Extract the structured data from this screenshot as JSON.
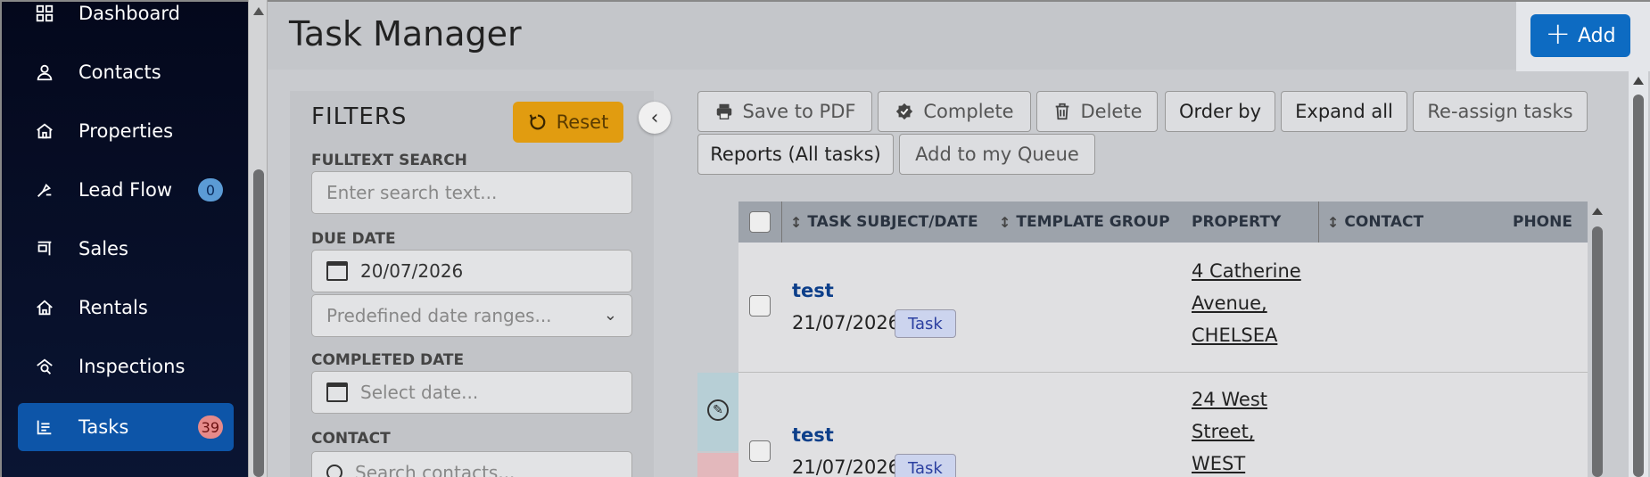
{
  "sidebar": {
    "items": [
      {
        "label": "Dashboard",
        "icon": "dashboard-icon"
      },
      {
        "label": "Contacts",
        "icon": "person-icon"
      },
      {
        "label": "Properties",
        "icon": "house-icon"
      },
      {
        "label": "Lead Flow",
        "icon": "lead-flow-icon",
        "badge": "0"
      },
      {
        "label": "Sales",
        "icon": "sales-sign-icon"
      },
      {
        "label": "Rentals",
        "icon": "rental-house-icon"
      },
      {
        "label": "Inspections",
        "icon": "inspection-icon"
      },
      {
        "label": "Tasks",
        "icon": "tasks-icon",
        "badge": "39"
      }
    ]
  },
  "header": {
    "title": "Task Manager",
    "add_label": "Add"
  },
  "filters": {
    "title": "FILTERS",
    "reset_label": "Reset",
    "fulltext_label": "FULLTEXT SEARCH",
    "fulltext_placeholder": "Enter search text...",
    "due_date_label": "DUE DATE",
    "due_date_value": "20/07/2026",
    "date_range_placeholder": "Predefined date ranges...",
    "completed_date_label": "COMPLETED DATE",
    "completed_date_placeholder": "Select date...",
    "contact_label": "CONTACT",
    "contact_placeholder": "Search contacts..."
  },
  "toolbar": {
    "save_pdf": "Save to PDF",
    "complete": "Complete",
    "delete": "Delete",
    "order_by": "Order by",
    "expand_all": "Expand all",
    "reassign": "Re-assign tasks",
    "reports": "Reports (All tasks)",
    "add_queue": "Add to my Queue"
  },
  "table": {
    "columns": [
      "TASK SUBJECT/DATE",
      "TEMPLATE GROUP",
      "PROPERTY",
      "CONTACT",
      "PHONE"
    ],
    "rows": [
      {
        "subject": "test",
        "date": "21/07/2026",
        "tag": "Task",
        "property": [
          "4 Catherine",
          "Avenue,",
          "CHELSEA"
        ]
      },
      {
        "subject": "test",
        "date": "21/07/2026",
        "tag": "Task",
        "property": [
          "24 West",
          "Street,",
          "WEST"
        ]
      }
    ]
  },
  "colors": {
    "accent": "#0d6bc2",
    "reset": "#e19c10",
    "active_nav": "#0d55a8"
  }
}
